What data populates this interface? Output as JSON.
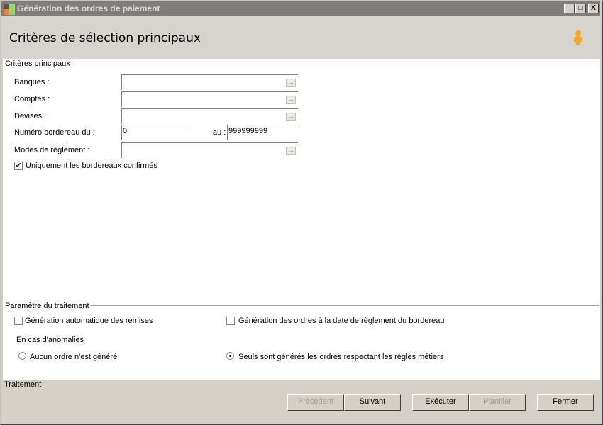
{
  "window": {
    "title": "Génération des ordres de paiement",
    "minimize": "_",
    "maximize": "□",
    "close": "X"
  },
  "header": {
    "title": "Critères de sélection principaux",
    "icon": "user-icon"
  },
  "criteria": {
    "group_label": "Critères principaux",
    "banques_label": "Banques :",
    "banques_value": "",
    "comptes_label": "Comptes :",
    "comptes_value": "",
    "devises_label": "Devises :",
    "devises_value": "",
    "numero_label": "Numéro bordereau du :",
    "numero_from": "0",
    "au_label": "au :",
    "numero_to": "999999999",
    "modes_label": "Modes de règlement :",
    "modes_value": "",
    "browse": "...",
    "confirmed_label": "Uniquement les bordereaux confirmés",
    "confirmed_checked": true
  },
  "params": {
    "group_label": "Paramètre du traitement",
    "auto_remises_label": "Génération automatique des remises",
    "auto_remises_checked": false,
    "date_reglement_label": "Génération des ordres à la date de règlement du bordereau",
    "date_reglement_checked": false,
    "anomalies_label": "En cas d'anomalies",
    "radio_none_label": "Aucun ordre n'est généré",
    "radio_rules_label": "Seuls sont générés les ordres respectant les règles métiers",
    "selected": "rules"
  },
  "footer": {
    "group_label": "Traitement",
    "buttons": {
      "previous": "Précédent",
      "next": "Suivant",
      "execute": "Exécuter",
      "schedule": "Planifier",
      "close": "Fermer"
    }
  }
}
